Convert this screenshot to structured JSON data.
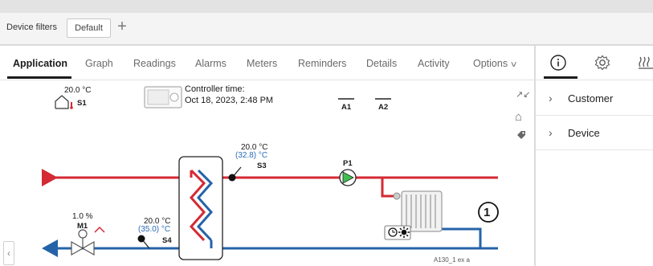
{
  "filterbar": {
    "label": "Device filters",
    "chip": "Default",
    "add_symbol": "+"
  },
  "tabs": [
    {
      "label": "Application",
      "active": true
    },
    {
      "label": "Graph"
    },
    {
      "label": "Readings"
    },
    {
      "label": "Alarms"
    },
    {
      "label": "Meters"
    },
    {
      "label": "Reminders"
    },
    {
      "label": "Details"
    },
    {
      "label": "Activity"
    },
    {
      "label": "Options"
    }
  ],
  "right_panel": {
    "tab_icons": [
      "info-icon",
      "settings-gear-icon",
      "heating-icon"
    ],
    "items": [
      {
        "label": "Customer"
      },
      {
        "label": "Device"
      }
    ]
  },
  "diagram": {
    "s1": {
      "value": "20.0 °C",
      "label": "S1"
    },
    "controller_time": {
      "label": "Controller time:",
      "value": "Oct 18, 2023, 2:48 PM"
    },
    "a1": "A1",
    "a2": "A2",
    "s3": {
      "value": "20.0 °C",
      "value2": "(32.8) °C",
      "label": "S3"
    },
    "p1": "P1",
    "m1": {
      "value": "1.0 %",
      "label": "M1"
    },
    "s4": {
      "value": "20.0 °C",
      "value2": "(35.0) °C",
      "label": "S4"
    },
    "circuit_number": "1",
    "footer_code": "A130_1 ex  a",
    "colors": {
      "supply": "#d42a34",
      "return": "#2563a8",
      "pump": "#3fbf4f"
    }
  },
  "icons": [
    "house-thermometer-icon",
    "controller-icon",
    "expand-icon",
    "home-icon",
    "tag-icon",
    "pump-icon",
    "valve-icon",
    "heat-exchanger-icon",
    "radiator-icon",
    "clock-icon",
    "sun-icon",
    "chevron-left-icon"
  ]
}
